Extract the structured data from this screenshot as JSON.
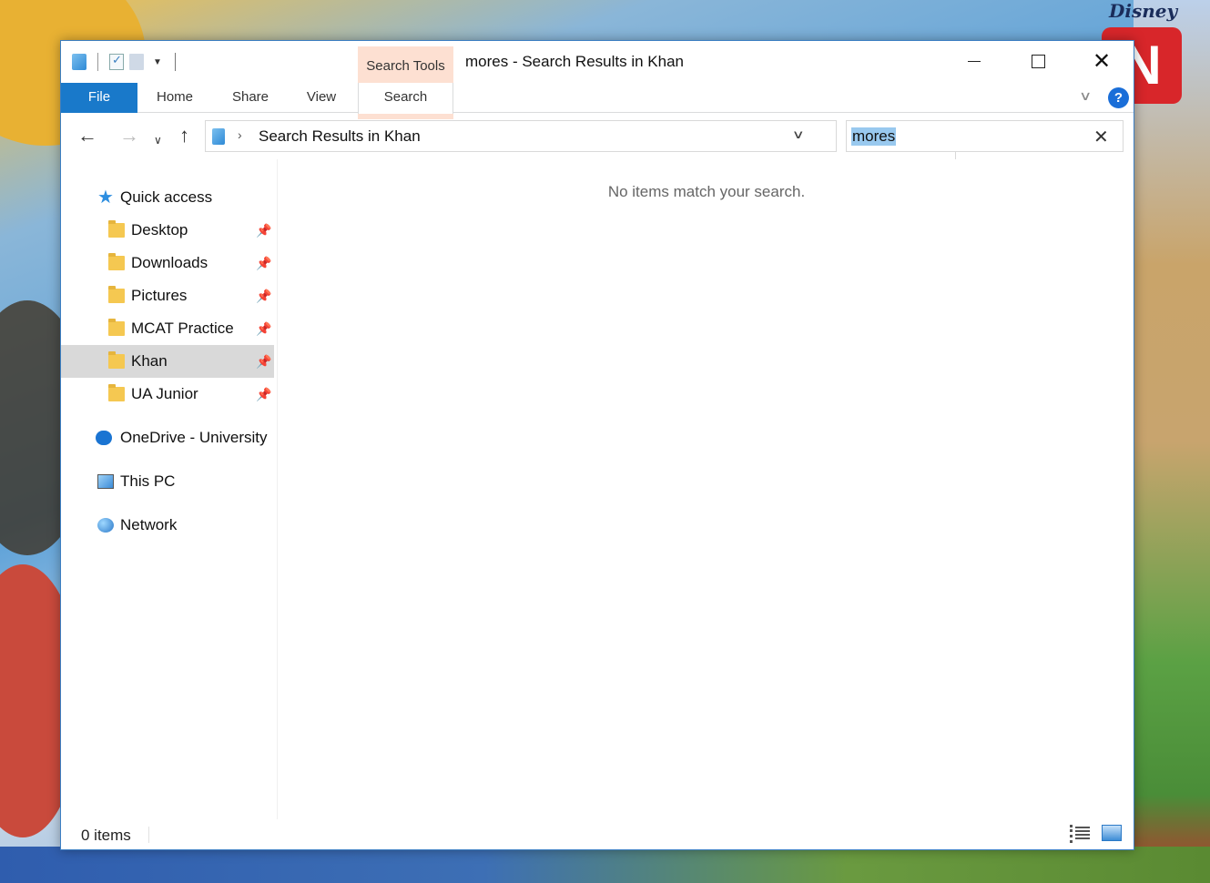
{
  "window": {
    "title": "mores - Search Results in Khan",
    "context_tab_group": "Search Tools"
  },
  "ribbon": {
    "tabs": [
      "File",
      "Home",
      "Share",
      "View",
      "Search"
    ]
  },
  "address": {
    "path": "Search Results in Khan"
  },
  "search": {
    "value": "mores"
  },
  "navpane": {
    "quick_access": "Quick access",
    "items": [
      "Desktop",
      "Downloads",
      "Pictures",
      "MCAT Practice",
      "Khan",
      "UA Junior"
    ],
    "selected": "Khan",
    "onedrive": "OneDrive - University",
    "this_pc": "This PC",
    "network": "Network"
  },
  "content": {
    "empty_message": "No items match your search."
  },
  "status": {
    "count": "0 items"
  },
  "background": {
    "brand_text": "Disney",
    "logo_letter": "N"
  },
  "colors": {
    "file_tab": "#1979ca",
    "context_tab": "#fde0d2",
    "search_highlight": "#99c9ef",
    "selected_nav": "#d9d9d9"
  }
}
